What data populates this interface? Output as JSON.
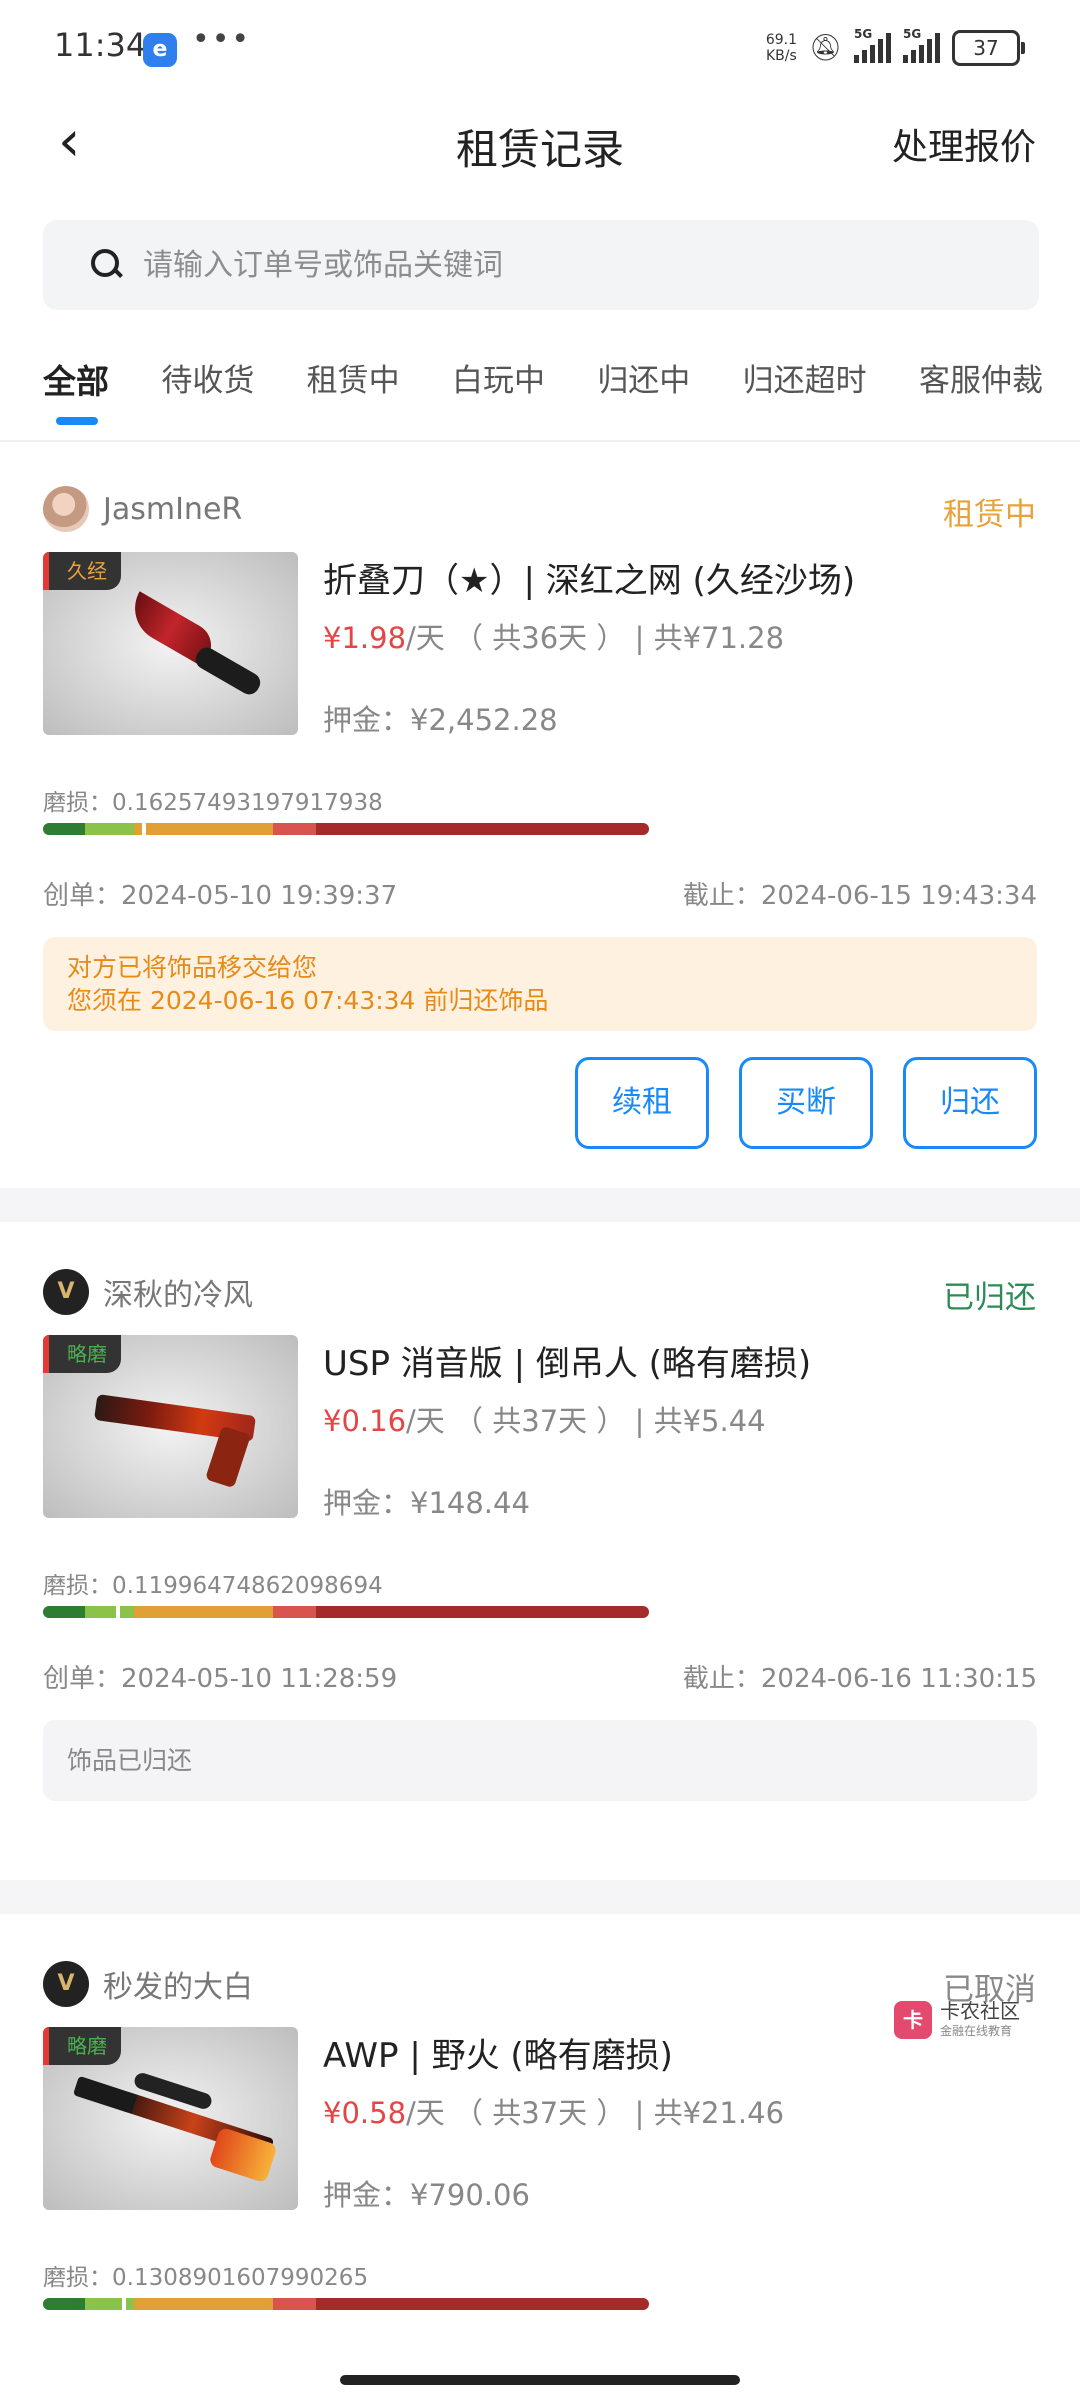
{
  "status_bar": {
    "time": "11:34",
    "net_speed": "69.1\nKB/s",
    "net_type": "5G",
    "battery": "37"
  },
  "nav": {
    "title": "租赁记录",
    "action": "处理报价"
  },
  "search": {
    "placeholder": "请输入订单号或饰品关键词"
  },
  "tabs": [
    "全部",
    "待收货",
    "租赁中",
    "白玩中",
    "归还中",
    "归还超时",
    "客服仲裁"
  ],
  "orders": [
    {
      "seller": "JasmIneR",
      "status": "租赁中",
      "status_color": "#e8a23a",
      "wear_tag": "久经",
      "wear_tag_color": "#e8a23a",
      "name": "折叠刀（★）| 深红之网 (久经沙场)",
      "price": "¥1.98",
      "per_day": "/天",
      "days": "（ 共36天 ）",
      "total": "| 共¥71.28",
      "deposit": "押金：¥2,452.28",
      "wear": "磨损：0.16257493197917938",
      "wear_value": 0.16257493197917938,
      "created": "创单：2024-05-10 19:39:37",
      "deadline": "截止：2024-06-15 19:43:34",
      "notice": [
        "对方已将饰品移交给您",
        "您须在 2024-06-16 07:43:34 前归还饰品"
      ],
      "buttons": [
        "续租",
        "买断",
        "归还"
      ]
    },
    {
      "seller": "深秋的冷风",
      "status": "已归还",
      "status_color": "#2e8b57",
      "wear_tag": "略磨",
      "wear_tag_color": "#4caf50",
      "name": "USP 消音版 | 倒吊人 (略有磨损)",
      "price": "¥0.16",
      "per_day": "/天",
      "days": "（ 共37天 ）",
      "total": "| 共¥5.44",
      "deposit": "押金：¥148.44",
      "wear": "磨损：0.11996474862098694",
      "wear_value": 0.11996474862098694,
      "created": "创单：2024-05-10 11:28:59",
      "deadline": "截止：2024-06-16 11:30:15",
      "notice": [
        "饰品已归还"
      ]
    },
    {
      "seller": "秒发的大白",
      "status": "已取消",
      "status_color": "#888888",
      "wear_tag": "略磨",
      "wear_tag_color": "#4caf50",
      "name": "AWP | 野火 (略有磨损)",
      "price": "¥0.58",
      "per_day": "/天",
      "days": "（ 共37天 ）",
      "total": "| 共¥21.46",
      "deposit": "押金：¥790.06",
      "wear": "磨损：0.1308901607990265",
      "wear_value": 0.1308901607990265
    }
  ],
  "watermark": {
    "name": "卡农社区",
    "sub": "金融在线教育"
  },
  "colors": {
    "accent": "#1989fa",
    "price": "#e54545"
  }
}
